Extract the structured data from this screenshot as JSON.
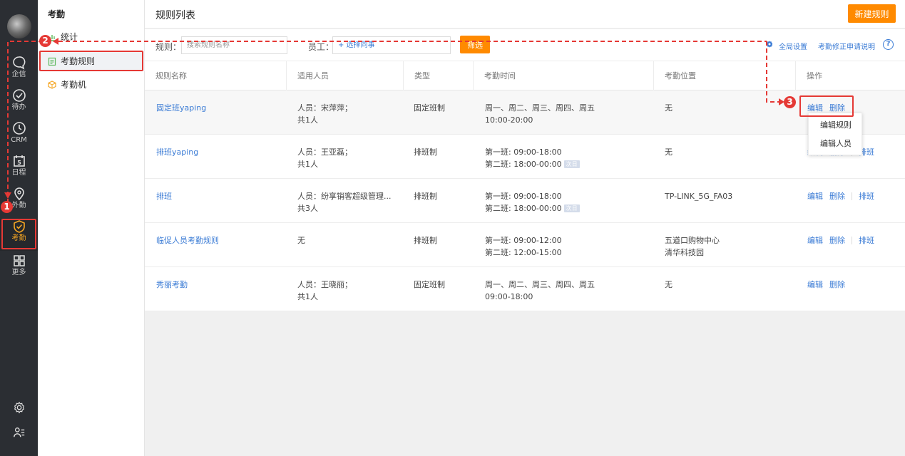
{
  "rail": {
    "items": [
      {
        "label": "企信",
        "icon": "chat-icon"
      },
      {
        "label": "待办",
        "icon": "todo-check-icon"
      },
      {
        "label": "CRM",
        "icon": "clock-icon"
      },
      {
        "label": "日程",
        "icon": "calendar-icon",
        "badge": "5"
      },
      {
        "label": "外勤",
        "icon": "location-pin-icon"
      },
      {
        "label": "考勤",
        "icon": "attendance-check-icon",
        "active": true
      },
      {
        "label": "更多",
        "icon": "grid-icon"
      }
    ],
    "bottom_icons": [
      "settings-gear-icon",
      "user-list-icon"
    ]
  },
  "subnav": {
    "title": "考勤",
    "items": [
      {
        "label": "统计"
      },
      {
        "label": "考勤规则",
        "active": true
      },
      {
        "label": "考勤机"
      }
    ]
  },
  "header": {
    "title": "规则列表",
    "new_button": "新建规则"
  },
  "filters": {
    "rule_label": "规则：",
    "rule_placeholder": "搜索规则名称",
    "staff_label": "员工：",
    "staff_placeholder": "+ 选择同事",
    "filter_button": "筛选",
    "global_settings": "全局设置",
    "correction_help": "考勤修正申请说明",
    "help_symbol": "?"
  },
  "table": {
    "columns": [
      "规则名称",
      "适用人员",
      "类型",
      "考勤时间",
      "考勤位置",
      "操作"
    ],
    "rows": [
      {
        "name": "固定班yaping",
        "people": [
          "人员：宋萍萍；",
          "共1人"
        ],
        "type": "固定班制",
        "time": [
          "周一、周二、周三、周四、周五",
          "10:00-20:00"
        ],
        "location": [
          "无"
        ],
        "ops": [
          "编辑",
          "删除"
        ]
      },
      {
        "name": "排班yaping",
        "people": [
          "人员：王亚磊；",
          "共1人"
        ],
        "type": "排班制",
        "time": [
          "第一班: 09:00-18:00",
          "第二班: 18:00-00:00"
        ],
        "time_tag": "次日",
        "location": [
          "无"
        ],
        "ops": [
          "编辑",
          "删除",
          "排班"
        ]
      },
      {
        "name": "排班",
        "people": [
          "人员：纷享销客超级管理...",
          "共3人"
        ],
        "type": "排班制",
        "time": [
          "第一班: 09:00-18:00",
          "第二班: 18:00-00:00"
        ],
        "time_tag": "次日",
        "location": [
          "TP-LINK_5G_FA03"
        ],
        "ops": [
          "编辑",
          "删除",
          "排班"
        ]
      },
      {
        "name": "临促人员考勤规则",
        "people": [
          "无",
          ""
        ],
        "type": "排班制",
        "time": [
          "第一班: 09:00-12:00",
          "第二班: 12:00-15:00"
        ],
        "location": [
          "五道口购物中心",
          "清华科技园"
        ],
        "ops": [
          "编辑",
          "删除",
          "排班"
        ]
      },
      {
        "name": "秀丽考勤",
        "people": [
          "人员：王晓丽；",
          "共1人"
        ],
        "type": "固定班制",
        "time": [
          "周一、周二、周三、周四、周五",
          "09:00-18:00"
        ],
        "location": [
          "无"
        ],
        "ops": [
          "编辑",
          "删除"
        ]
      }
    ]
  },
  "dropdown": {
    "items": [
      "编辑规则",
      "编辑人员"
    ]
  },
  "annotations": {
    "step1": "1",
    "step2": "2",
    "step3": "3",
    "color": "#e53935"
  },
  "colors": {
    "accent": "#ff8a00",
    "link": "#3a7bd5",
    "rail_bg": "#2b2e33"
  }
}
